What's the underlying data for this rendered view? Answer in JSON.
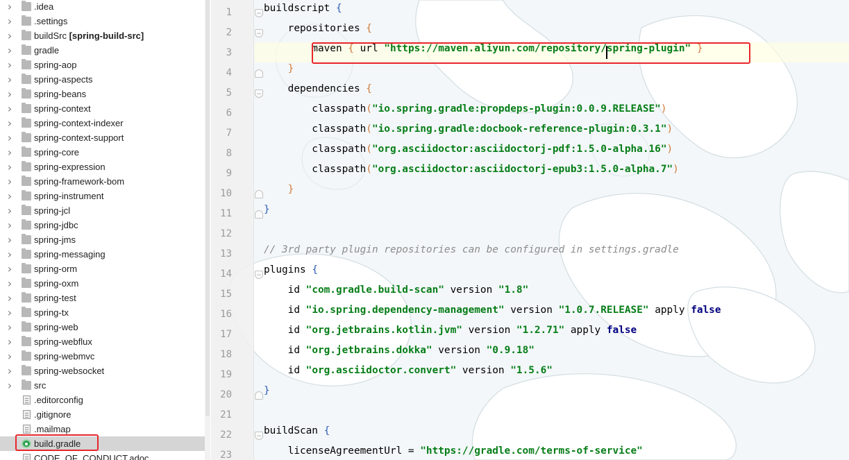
{
  "tree": {
    "items": [
      {
        "label": ".idea",
        "kind": "folder",
        "expandable": true
      },
      {
        "label": ".settings",
        "kind": "folder",
        "expandable": true
      },
      {
        "label": "buildSrc",
        "suffix": "[spring-build-src]",
        "kind": "folder",
        "expandable": true
      },
      {
        "label": "gradle",
        "kind": "folder",
        "expandable": true
      },
      {
        "label": "spring-aop",
        "kind": "folder",
        "expandable": true
      },
      {
        "label": "spring-aspects",
        "kind": "folder",
        "expandable": true
      },
      {
        "label": "spring-beans",
        "kind": "folder",
        "expandable": true
      },
      {
        "label": "spring-context",
        "kind": "folder",
        "expandable": true
      },
      {
        "label": "spring-context-indexer",
        "kind": "folder",
        "expandable": true
      },
      {
        "label": "spring-context-support",
        "kind": "folder",
        "expandable": true
      },
      {
        "label": "spring-core",
        "kind": "folder",
        "expandable": true
      },
      {
        "label": "spring-expression",
        "kind": "folder",
        "expandable": true
      },
      {
        "label": "spring-framework-bom",
        "kind": "folder",
        "expandable": true
      },
      {
        "label": "spring-instrument",
        "kind": "folder",
        "expandable": true
      },
      {
        "label": "spring-jcl",
        "kind": "folder",
        "expandable": true
      },
      {
        "label": "spring-jdbc",
        "kind": "folder",
        "expandable": true
      },
      {
        "label": "spring-jms",
        "kind": "folder",
        "expandable": true
      },
      {
        "label": "spring-messaging",
        "kind": "folder",
        "expandable": true
      },
      {
        "label": "spring-orm",
        "kind": "folder",
        "expandable": true
      },
      {
        "label": "spring-oxm",
        "kind": "folder",
        "expandable": true
      },
      {
        "label": "spring-test",
        "kind": "folder",
        "expandable": true
      },
      {
        "label": "spring-tx",
        "kind": "folder",
        "expandable": true
      },
      {
        "label": "spring-web",
        "kind": "folder",
        "expandable": true
      },
      {
        "label": "spring-webflux",
        "kind": "folder",
        "expandable": true
      },
      {
        "label": "spring-webmvc",
        "kind": "folder",
        "expandable": true
      },
      {
        "label": "spring-websocket",
        "kind": "folder",
        "expandable": true
      },
      {
        "label": "src",
        "kind": "folder",
        "expandable": true
      },
      {
        "label": ".editorconfig",
        "kind": "file",
        "expandable": false
      },
      {
        "label": ".gitignore",
        "kind": "file",
        "expandable": false
      },
      {
        "label": ".mailmap",
        "kind": "file",
        "expandable": false
      },
      {
        "label": "build.gradle",
        "kind": "gradle",
        "expandable": false,
        "selected": true
      },
      {
        "label": "CODE_OF_CONDUCT.adoc",
        "kind": "file",
        "expandable": false
      }
    ]
  },
  "editor": {
    "file": "build.gradle",
    "current_line": 3,
    "lines": [
      {
        "n": "1",
        "fold": "open",
        "tokens": [
          [
            "t",
            "buildscript "
          ],
          [
            "brb",
            "{"
          ]
        ]
      },
      {
        "n": "2",
        "fold": "open",
        "tokens": [
          [
            "t",
            "    repositories "
          ],
          [
            "br",
            "{"
          ]
        ]
      },
      {
        "n": "3",
        "fold": "",
        "tokens": [
          [
            "t",
            "        maven "
          ],
          [
            "br",
            "{"
          ],
          [
            "t",
            " url "
          ],
          [
            "str",
            "\"https://maven.aliyun.com/repository/spring-plugin\""
          ],
          [
            "t",
            " "
          ],
          [
            "br",
            "}"
          ]
        ]
      },
      {
        "n": "4",
        "fold": "close",
        "tokens": [
          [
            "t",
            "    "
          ],
          [
            "br",
            "}"
          ]
        ]
      },
      {
        "n": "5",
        "fold": "open",
        "tokens": [
          [
            "t",
            "    dependencies "
          ],
          [
            "br",
            "{"
          ]
        ]
      },
      {
        "n": "6",
        "fold": "",
        "tokens": [
          [
            "t",
            "        classpath"
          ],
          [
            "br",
            "("
          ],
          [
            "str",
            "\"io.spring.gradle:propdeps-plugin:0.0.9.RELEASE\""
          ],
          [
            "br",
            ")"
          ]
        ]
      },
      {
        "n": "7",
        "fold": "",
        "tokens": [
          [
            "t",
            "        classpath"
          ],
          [
            "br",
            "("
          ],
          [
            "str",
            "\"io.spring.gradle:docbook-reference-plugin:0.3.1\""
          ],
          [
            "br",
            ")"
          ]
        ]
      },
      {
        "n": "8",
        "fold": "",
        "tokens": [
          [
            "t",
            "        classpath"
          ],
          [
            "br",
            "("
          ],
          [
            "str",
            "\"org.asciidoctor:asciidoctorj-pdf:1.5.0-alpha.16\""
          ],
          [
            "br",
            ")"
          ]
        ]
      },
      {
        "n": "9",
        "fold": "",
        "tokens": [
          [
            "t",
            "        classpath"
          ],
          [
            "br",
            "("
          ],
          [
            "str",
            "\"org.asciidoctor:asciidoctorj-epub3:1.5.0-alpha.7\""
          ],
          [
            "br",
            ")"
          ]
        ]
      },
      {
        "n": "10",
        "fold": "close",
        "tokens": [
          [
            "t",
            "    "
          ],
          [
            "br",
            "}"
          ]
        ]
      },
      {
        "n": "11",
        "fold": "close",
        "tokens": [
          [
            "brb",
            "}"
          ]
        ]
      },
      {
        "n": "12",
        "fold": "",
        "tokens": [
          [
            "t",
            ""
          ]
        ]
      },
      {
        "n": "13",
        "fold": "",
        "tokens": [
          [
            "cmt",
            "// 3rd party plugin repositories can be configured in settings.gradle"
          ]
        ]
      },
      {
        "n": "14",
        "fold": "open",
        "tokens": [
          [
            "t",
            "plugins "
          ],
          [
            "brb",
            "{"
          ]
        ]
      },
      {
        "n": "15",
        "fold": "",
        "tokens": [
          [
            "t",
            "    id "
          ],
          [
            "str",
            "\"com.gradle.build-scan\""
          ],
          [
            "t",
            " version "
          ],
          [
            "str",
            "\"1.8\""
          ]
        ]
      },
      {
        "n": "16",
        "fold": "",
        "tokens": [
          [
            "t",
            "    id "
          ],
          [
            "str",
            "\"io.spring.dependency-management\""
          ],
          [
            "t",
            " version "
          ],
          [
            "str",
            "\"1.0.7.RELEASE\""
          ],
          [
            "t",
            " apply "
          ],
          [
            "kw",
            "false"
          ]
        ]
      },
      {
        "n": "17",
        "fold": "",
        "tokens": [
          [
            "t",
            "    id "
          ],
          [
            "str",
            "\"org.jetbrains.kotlin.jvm\""
          ],
          [
            "t",
            " version "
          ],
          [
            "str",
            "\"1.2.71\""
          ],
          [
            "t",
            " apply "
          ],
          [
            "kw",
            "false"
          ]
        ]
      },
      {
        "n": "18",
        "fold": "",
        "tokens": [
          [
            "t",
            "    id "
          ],
          [
            "str",
            "\"org.jetbrains.dokka\""
          ],
          [
            "t",
            " version "
          ],
          [
            "str",
            "\"0.9.18\""
          ]
        ]
      },
      {
        "n": "19",
        "fold": "",
        "tokens": [
          [
            "t",
            "    id "
          ],
          [
            "str",
            "\"org.asciidoctor.convert\""
          ],
          [
            "t",
            " version "
          ],
          [
            "str",
            "\"1.5.6\""
          ]
        ]
      },
      {
        "n": "20",
        "fold": "close",
        "tokens": [
          [
            "brb",
            "}"
          ]
        ]
      },
      {
        "n": "21",
        "fold": "",
        "tokens": [
          [
            "t",
            ""
          ]
        ]
      },
      {
        "n": "22",
        "fold": "open",
        "tokens": [
          [
            "t",
            "buildScan "
          ],
          [
            "brb",
            "{"
          ]
        ]
      },
      {
        "n": "23",
        "fold": "",
        "tokens": [
          [
            "t",
            "    licenseAgreementUrl = "
          ],
          [
            "str",
            "\"https://gradle.com/terms-of-service\""
          ]
        ]
      }
    ]
  },
  "colors": {
    "highlight_box": "#e8262b",
    "string": "#067d17",
    "keyword": "#000080",
    "comment": "#8c8c8c"
  }
}
